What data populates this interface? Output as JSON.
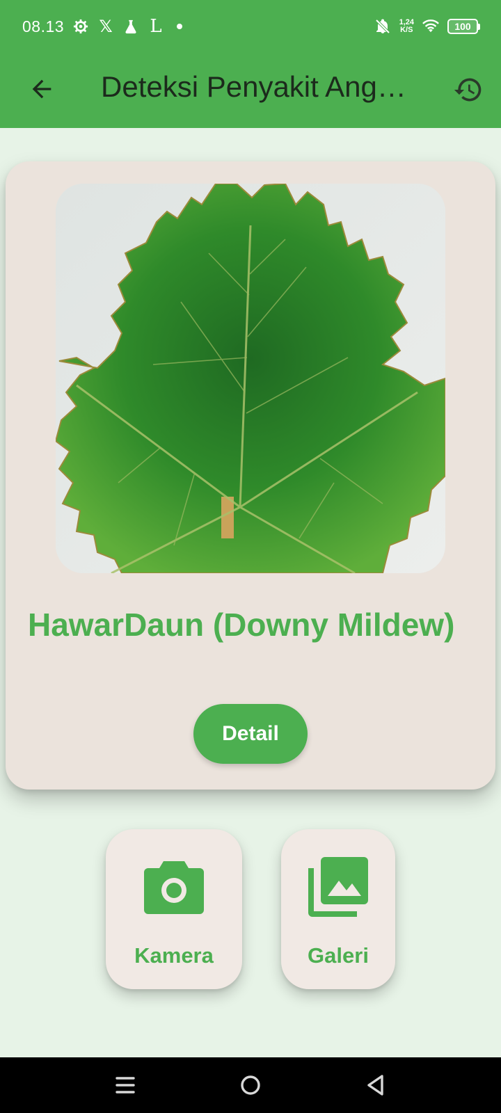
{
  "status_bar": {
    "time": "08.13",
    "icons_left": [
      "settings-gear-icon",
      "x-logo-icon",
      "lab-flask-icon",
      "letter-l-icon",
      "dot-icon"
    ],
    "net_speed_value": "1,24",
    "net_speed_unit": "K/S",
    "battery": "100"
  },
  "app_bar": {
    "title": "Deteksi Penyakit Ang…",
    "back_icon": "arrow-back-icon",
    "history_icon": "history-icon"
  },
  "result_card": {
    "image_description": "grape-leaf-photo",
    "title": "HawarDaun (Downy Mildew)",
    "detail_label": "Detail"
  },
  "actions": [
    {
      "label": "Kamera",
      "icon": "camera-icon"
    },
    {
      "label": "Galeri",
      "icon": "gallery-icon"
    }
  ],
  "colors": {
    "primary": "#4caf50",
    "background": "#e7f3e7",
    "card": "#ebe3dc",
    "tile": "#f1e9e4"
  }
}
